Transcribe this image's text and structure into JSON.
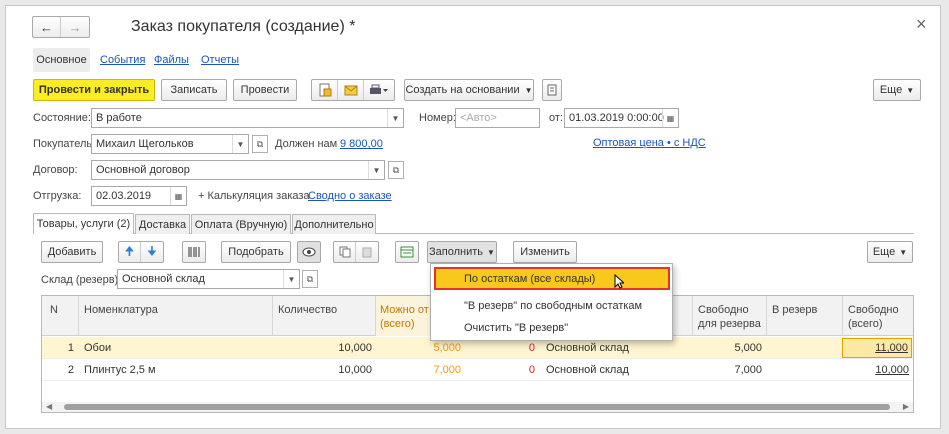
{
  "window": {
    "title": "Заказ покупателя (создание) *",
    "back_icon": "arrow-left",
    "forward_icon": "arrow-right",
    "close_icon": "×"
  },
  "nav_tabs": [
    "Основное",
    "События",
    "Файлы",
    "Отчеты"
  ],
  "toolbar": {
    "post_close": "Провести и закрыть",
    "save": "Записать",
    "post": "Провести",
    "create_based": "Создать на основании",
    "more": "Еще"
  },
  "form": {
    "state_label": "Состояние:",
    "state_value": "В работе",
    "number_label": "Номер:",
    "number_placeholder": "<Авто>",
    "from_label": "от:",
    "date_value": "01.03.2019  0:00:00",
    "price_link": "Оптовая цена • с НДС",
    "buyer_label": "Покупатель:",
    "buyer_value": "Михаил Щегольков",
    "debt_label": "Должен нам",
    "debt_value": "9 800,00",
    "contract_label": "Договор:",
    "contract_value": "Основной договор",
    "shipment_label": "Отгрузка:",
    "shipment_date": "02.03.2019",
    "calc_link": "+ Калькуляция заказа",
    "summary_link": "Сводно о заказе"
  },
  "inner_tabs": [
    "Товары, услуги (2)",
    "Доставка",
    "Оплата (Вручную)",
    "Дополнительно"
  ],
  "table_toolbar": {
    "add": "Добавить",
    "pick": "Подобрать",
    "fill": "Заполнить",
    "change": "Изменить",
    "more": "Еще"
  },
  "warehouse": {
    "label": "Склад (резерв):",
    "value": "Основной склад"
  },
  "columns": {
    "n": "N",
    "item": "Номенклатура",
    "qty": "Количество",
    "can_ship_1": "Можно от",
    "can_ship_2": "(всего)",
    "warehouse": "",
    "free_reserve_1": "Свободно",
    "free_reserve_2": "для резерва",
    "in_reserve": "В резерв",
    "free_total_1": "Свободно",
    "free_total_2": "(всего)"
  },
  "rows": [
    {
      "n": "1",
      "item": "Обои",
      "qty": "10,000",
      "can_ship": "5,000",
      "reserve": "0",
      "warehouse": "Основной склад",
      "free_reserve": "5,000",
      "free_total": "11,000"
    },
    {
      "n": "2",
      "item": "Плинтус 2,5 м",
      "qty": "10,000",
      "can_ship": "7,000",
      "reserve": "0",
      "warehouse": "Основной склад",
      "free_reserve": "7,000",
      "free_total": "10,000"
    }
  ],
  "fill_menu": {
    "items": [
      "По остаткам (все склады)",
      "\"В резерв\" по свободным остаткам",
      "Очистить \"В резерв\""
    ]
  },
  "colors": {
    "primary_button": "#fbed24",
    "selected_row": "#fff5d0",
    "highlight_item": "#f9c81d",
    "highlight_border": "#e3342a",
    "orange_value": "#f39c12",
    "red_value": "#e02020",
    "link": "#1a55b9"
  }
}
